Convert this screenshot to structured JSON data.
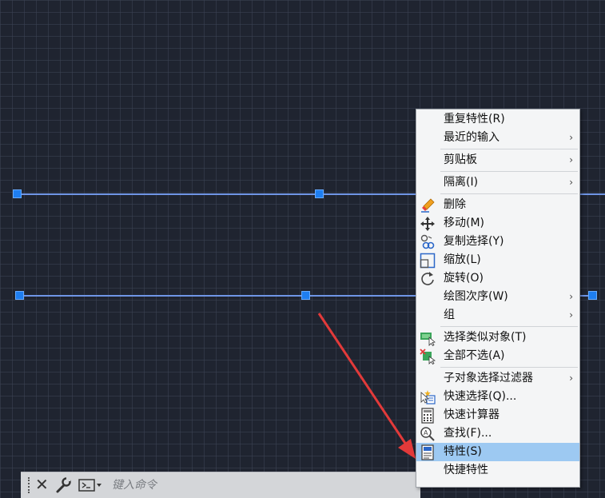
{
  "command_bar": {
    "placeholder": "键入命令"
  },
  "context_menu": {
    "items": [
      {
        "label": "重复特性(R)"
      },
      {
        "label": "最近的输入",
        "submenu": true
      },
      {
        "label": "剪贴板",
        "submenu": true
      },
      {
        "label": "隔离(I)",
        "submenu": true
      },
      {
        "label": "删除"
      },
      {
        "label": "移动(M)"
      },
      {
        "label": "复制选择(Y)"
      },
      {
        "label": "缩放(L)"
      },
      {
        "label": "旋转(O)"
      },
      {
        "label": "绘图次序(W)",
        "submenu": true
      },
      {
        "label": "组",
        "submenu": true
      },
      {
        "label": "选择类似对象(T)"
      },
      {
        "label": "全部不选(A)"
      },
      {
        "label": "子对象选择过滤器",
        "submenu": true
      },
      {
        "label": "快速选择(Q)..."
      },
      {
        "label": "快速计算器"
      },
      {
        "label": "查找(F)..."
      },
      {
        "label": "特性(S)",
        "highlighted": true
      },
      {
        "label": "快捷特性"
      }
    ],
    "submenu_glyph": "›"
  },
  "colors": {
    "canvas": "#1f2430",
    "line": "#6f95e6",
    "grip": "#1e7ef0",
    "highlight": "#9dc9f2",
    "annotation_arrow": "#e23a3a"
  }
}
